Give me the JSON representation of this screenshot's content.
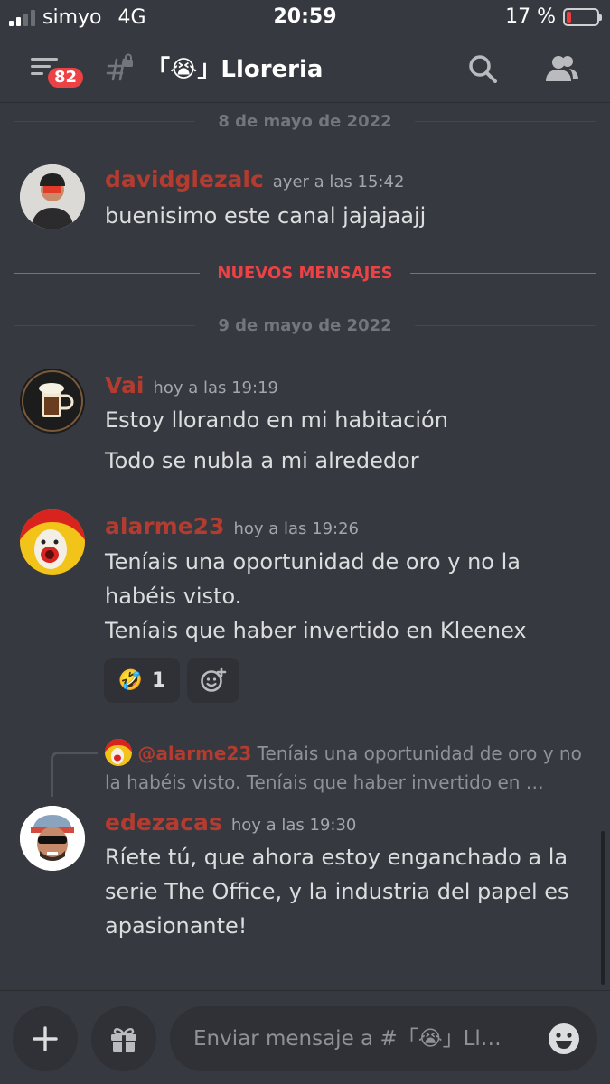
{
  "status_bar": {
    "carrier": "simyo",
    "network": "4G",
    "time": "20:59",
    "battery": "17 %",
    "battery_level": 0.17
  },
  "header": {
    "notification_count": "82",
    "channel_name": "「😭」Lloreria"
  },
  "dates": {
    "first": "8 de mayo de 2022",
    "new_messages": "NUEVOS MENSAJES",
    "second": "9 de mayo de 2022"
  },
  "messages": [
    {
      "username": "davidglezalc",
      "timestamp": "ayer a las 15:42",
      "lines": [
        "buenisimo este canal jajajaajj"
      ]
    },
    {
      "username": "Vai",
      "timestamp": "hoy a las 19:19",
      "lines": [
        "Estoy llorando en mi habitación",
        "Todo se nubla a mi alrededor"
      ]
    },
    {
      "username": "alarme23",
      "timestamp": "hoy a las 19:26",
      "lines": [
        "Teníais una oportunidad de oro y no la habéis visto.",
        "Teníais que haber invertido en Kleenex"
      ]
    },
    {
      "username": "edezacas",
      "timestamp": "hoy a las 19:30",
      "lines": [
        "Ríete tú, que ahora estoy enganchado a la serie The Office, y la industria del papel es apasionante!"
      ]
    }
  ],
  "reaction": {
    "emoji": "🤣",
    "count": "1"
  },
  "reply": {
    "mention": "@alarme23",
    "preview": "Teníais una oportunidad de oro y no la habéis visto. Teníais que haber invertido en …"
  },
  "composer": {
    "placeholder": "Enviar mensaje a #「😭」Ll…"
  },
  "icons": {
    "menu": "menu-icon",
    "hash": "hashtag-lock-icon",
    "search": "search-icon",
    "members": "members-icon",
    "add": "plus-icon",
    "gift": "gift-icon",
    "emoji": "emoji-icon",
    "add_reaction": "add-reaction-icon"
  },
  "colors": {
    "background": "#36393f",
    "username": "#b43b2f",
    "new_messages": "#ed4245",
    "badge": "#ed4245"
  }
}
